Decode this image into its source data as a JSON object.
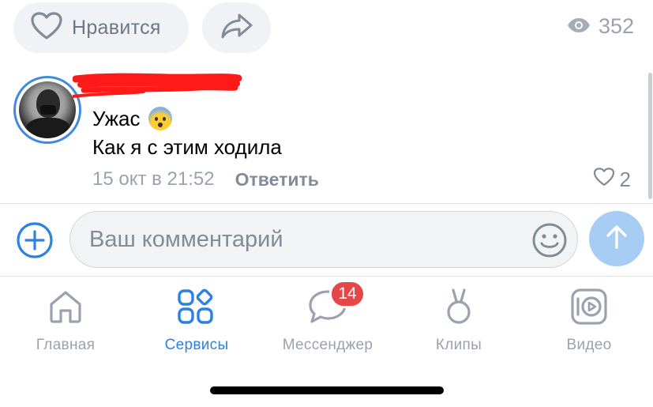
{
  "post_actions": {
    "like_label": "Нравится",
    "like_icon": "heart-icon",
    "share_icon": "share-arrow-icon",
    "views_icon": "eye-icon",
    "views_count": "352"
  },
  "comment": {
    "author_avatar": "avatar",
    "author_name_redacted": true,
    "text_line1": "Ужас",
    "text_line1_emoji": "fearful-face-emoji",
    "text_line2": "Как я с этим ходила",
    "timestamp": "15 окт в 21:52",
    "reply_label": "Ответить",
    "likes_count": "2"
  },
  "composer": {
    "placeholder": "Ваш комментарий",
    "add_icon": "plus-circle-icon",
    "emoji_icon": "smile-icon",
    "send_icon": "arrow-up-icon"
  },
  "tabbar": {
    "tabs": [
      {
        "label": "Главная",
        "icon": "home-icon",
        "active": false
      },
      {
        "label": "Сервисы",
        "icon": "services-icon",
        "active": true
      },
      {
        "label": "Мессенджер",
        "icon": "messenger-icon",
        "active": false,
        "badge": "14"
      },
      {
        "label": "Клипы",
        "icon": "clips-icon",
        "active": false
      },
      {
        "label": "Видео",
        "icon": "video-icon",
        "active": false
      }
    ]
  },
  "colors": {
    "accent": "#2d81e0",
    "muted": "#99a2ad",
    "badge": "#e64646",
    "send_disabled": "#a8cdf5",
    "redaction": "#ff1a1a"
  }
}
